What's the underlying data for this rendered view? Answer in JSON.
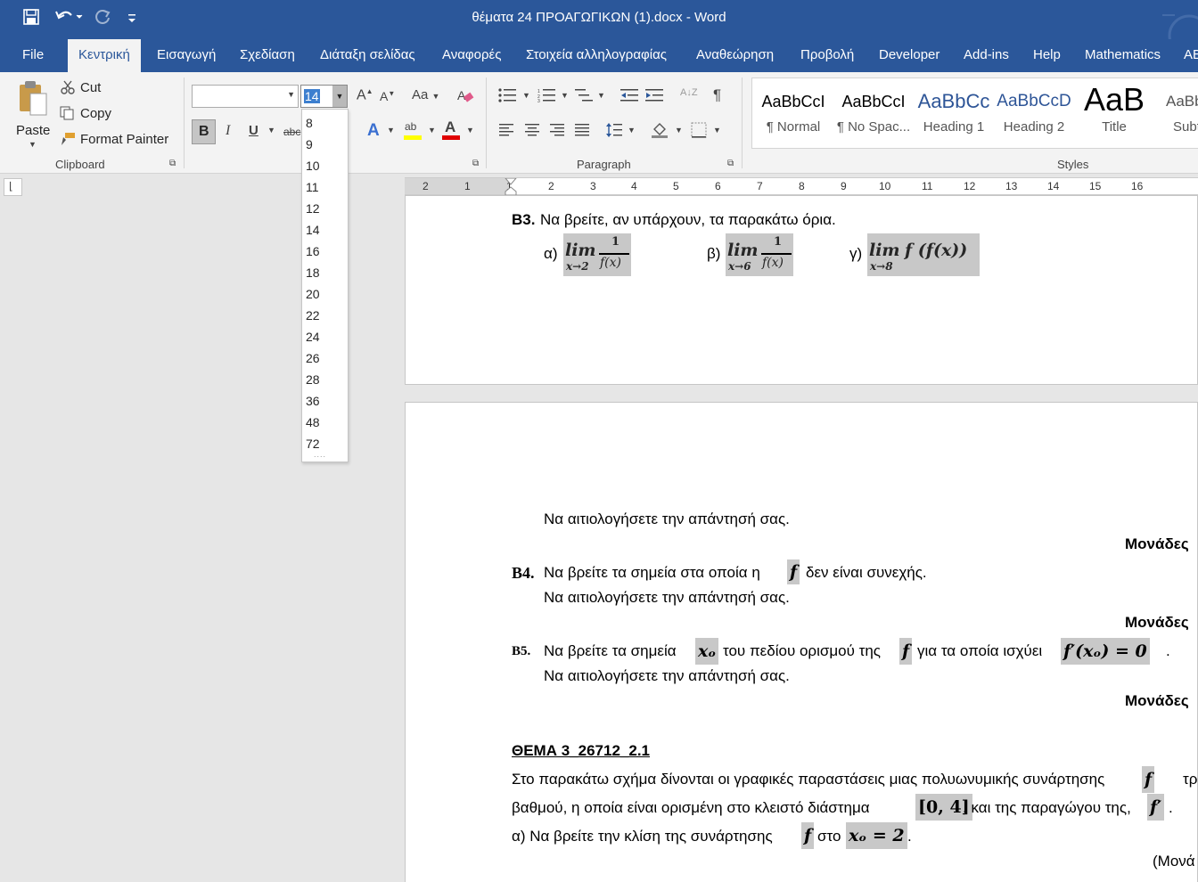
{
  "window": {
    "title": "θέματα 24 ΠΡΟΑΓΩΓΙΚΩΝ (1).docx  -  Word"
  },
  "qat": {
    "save_icon": "save-icon",
    "undo_icon": "undo-icon",
    "redo_icon": "redo-icon",
    "customize_icon": "customize-qat-icon"
  },
  "tabs": [
    "File",
    "Κεντρική",
    "Εισαγωγή",
    "Σχεδίαση",
    "Διάταξη σελίδας",
    "Αναφορές",
    "Στοιχεία αλληλογραφίας",
    "Αναθεώρηση",
    "Προβολή",
    "Developer",
    "Add-ins",
    "Help",
    "Mathematics",
    "AB"
  ],
  "clipboard": {
    "paste": "Paste",
    "cut": "Cut",
    "copy": "Copy",
    "format_painter": "Format Painter",
    "label": "Clipboard"
  },
  "font": {
    "name_value": "",
    "size_value": "14",
    "bold": "B",
    "italic": "I",
    "underline": "U",
    "strike": "abc",
    "grow": "A",
    "shrink": "A",
    "case": "Aa",
    "effects": "A",
    "highlight": "ab",
    "color": "A",
    "highlight_color": "#ffff00",
    "font_color": "#e00000"
  },
  "paragraph": {
    "label": "Paragraph",
    "pilcrow": "¶",
    "sort": "A↓Z"
  },
  "styles": {
    "label": "Styles",
    "items": [
      {
        "sample": "AaBbCcI",
        "name": "¶ Normal"
      },
      {
        "sample": "AaBbCcI",
        "name": "¶ No Spac..."
      },
      {
        "sample": "AaBbCc",
        "name": "Heading 1"
      },
      {
        "sample": "AaBbCcD",
        "name": "Heading 2"
      },
      {
        "sample": "AaB",
        "name": "Title"
      },
      {
        "sample": "AaBb",
        "name": "Subt"
      }
    ]
  },
  "font_size_options": [
    "8",
    "9",
    "10",
    "11",
    "12",
    "14",
    "16",
    "18",
    "20",
    "22",
    "24",
    "26",
    "28",
    "36",
    "48",
    "72"
  ],
  "ruler": {
    "numbers": [
      "2",
      "1",
      "1",
      "2",
      "3",
      "4",
      "5",
      "6",
      "7",
      "8",
      "9",
      "10",
      "11",
      "12",
      "13",
      "14",
      "15",
      "16"
    ]
  },
  "document": {
    "b3_label": "B3.",
    "b3_text": "Να βρείτε, αν υπάρχουν, τα παρακάτω όρια.",
    "limit_a_prefix": "α)",
    "limit_b_prefix": "β)",
    "limit_c_prefix": "γ)",
    "lim": "lim",
    "lim_a_sub": "x→2",
    "lim_b_sub": "x→6",
    "lim_c_sub": "x→8",
    "frac_num": "1",
    "frac_den": "f(x)",
    "lim_c_expr": "f (f(x))",
    "justify_1": "Να αιτιολογήσετε την απάντησή σας.",
    "monades": "Μονάδες",
    "b4_label": "B4.",
    "b4_text_1": "Να βρείτε τα σημεία στα οποία η",
    "f": "f",
    "b4_text_2": "δεν είναι συνεχής.",
    "justify_2": "Να αιτιολογήσετε την απάντησή σας.",
    "b5_label": "B5.",
    "b5_text_1": "Να βρείτε τα σημεία",
    "xo": "xₒ",
    "b5_text_2": "του πεδίου ορισμού της",
    "b5_text_3": "για τα οποία ισχύει",
    "b5_eq": "f′(xₒ) = 0",
    "justify_3": "Να αιτιολογήσετε την απάντησή σας.",
    "thema_heading": "ΘΕΜΑ 3_26712_2.1",
    "p1_text": "Στο παρακάτω σχήμα δίνονται οι γραφικές παραστάσεις μιας πολυωνυμικής συνάρτησης",
    "p1_tail": "τρ",
    "p2_text_1": "βαθμού, η οποία είναι ορισμένη στο κλειστό διάστημα",
    "interval": "[0, 4]",
    "p2_text_2": ", και της παραγώγου της,",
    "fprime": "f′",
    "p3_text_1": "α) Να βρείτε την κλίση της συνάρτησης",
    "p3_text_2": "στο",
    "xo_eq": "xₒ = 2",
    "monades_paren": "(Μονά"
  }
}
